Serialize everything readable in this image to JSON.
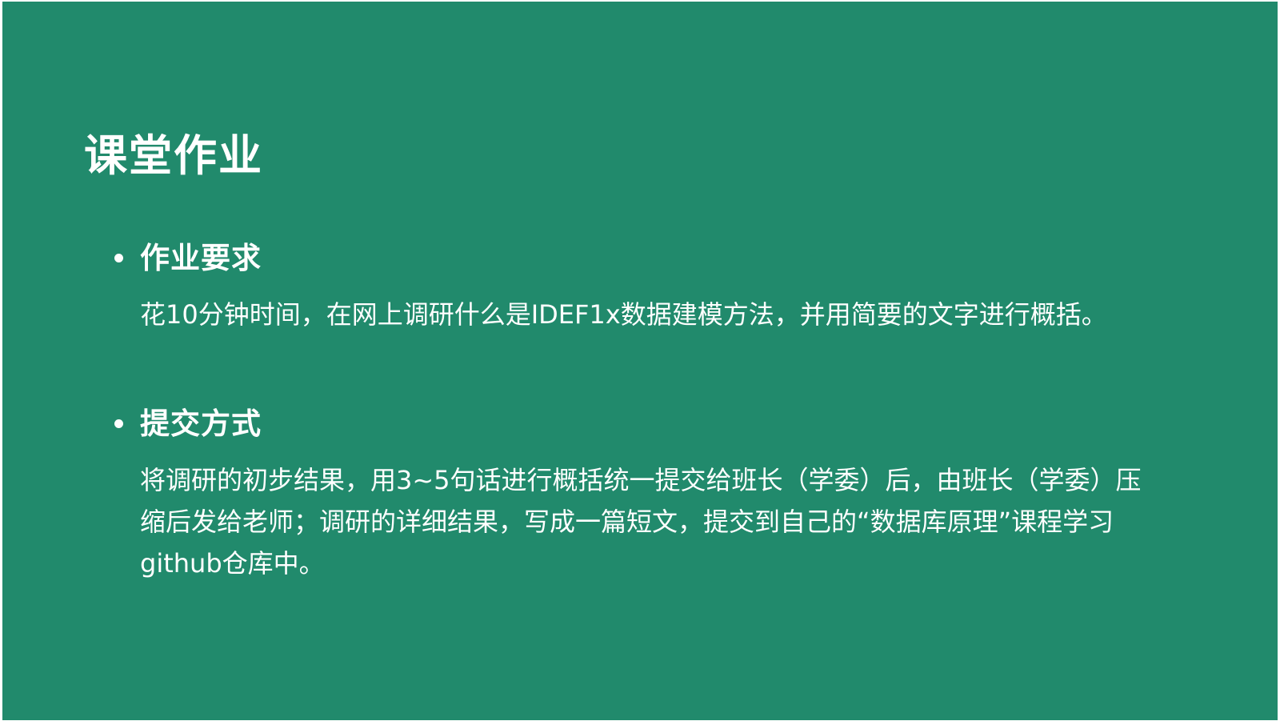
{
  "slide": {
    "title": "课堂作业",
    "background_color": "#218a6c",
    "text_color": "#ffffff",
    "bullets": [
      {
        "label": "作业要求",
        "body": "花10分钟时间，在网上调研什么是IDEF1x数据建模方法，并用简要的文字进行概括。"
      },
      {
        "label": "提交方式",
        "body": "将调研的初步结果，用3~5句话进行概括统一提交给班长（学委）后，由班长（学委）压缩后发给老师；调研的详细结果，写成一篇短文，提交到自己的“数据库原理”课程学习github仓库中。"
      }
    ]
  }
}
